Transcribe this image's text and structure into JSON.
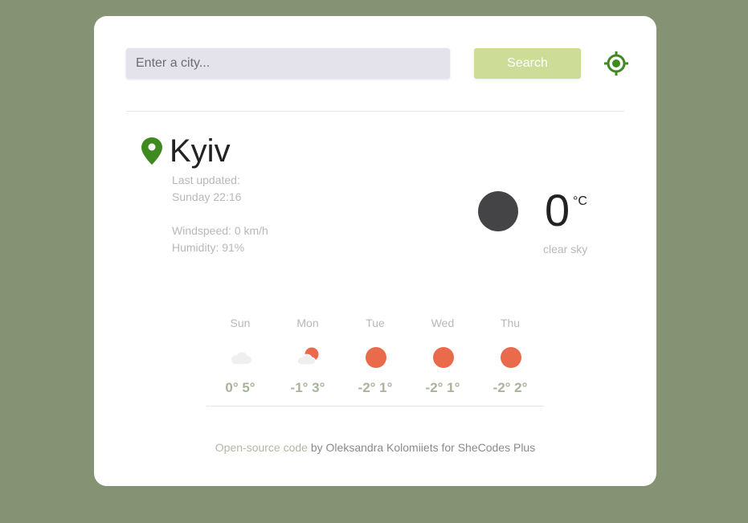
{
  "search": {
    "placeholder": "Enter a city...",
    "button_label": "Search"
  },
  "icons": {
    "locate": "crosshair-location-icon",
    "pin": "map-pin-icon",
    "current": "clear-night-icon"
  },
  "colors": {
    "background": "#859273",
    "accent_green": "#3f8a1f",
    "search_button": "#cddc97",
    "sun": "#ea6b4c",
    "night_icon": "#444446"
  },
  "current": {
    "city": "Kyiv",
    "last_updated_label": "Last updated:",
    "last_updated_value": "Sunday 22:16",
    "windspeed": "Windspeed: 0 km/h",
    "humidity": "Humidity: 91%",
    "temperature": "0",
    "unit": "°C",
    "description": "clear sky"
  },
  "forecast": [
    {
      "day": "Sun",
      "icon": "cloud-icon",
      "temps": "0° 5°"
    },
    {
      "day": "Mon",
      "icon": "partly-cloudy-icon",
      "temps": "-1° 3°"
    },
    {
      "day": "Tue",
      "icon": "sun-icon",
      "temps": "-2° 1°"
    },
    {
      "day": "Wed",
      "icon": "sun-icon",
      "temps": "-2° 1°"
    },
    {
      "day": "Thu",
      "icon": "sun-icon",
      "temps": "-2° 2°"
    }
  ],
  "footer": {
    "link_text": "Open-source code",
    "rest_text": " by Oleksandra Kolomiiets for SheCodes Plus"
  }
}
